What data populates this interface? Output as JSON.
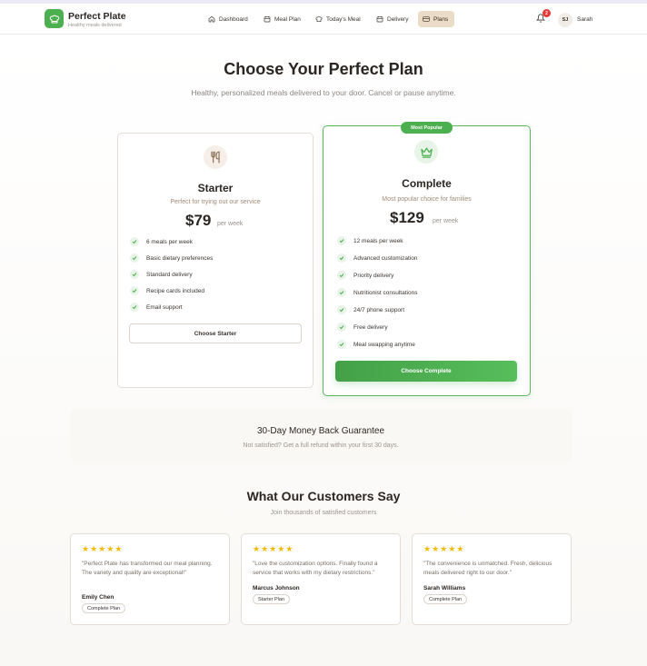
{
  "brand": {
    "name": "Perfect Plate",
    "tagline": "Healthy meals delivered"
  },
  "nav": {
    "items": [
      {
        "label": "Dashboard",
        "icon": "home-icon"
      },
      {
        "label": "Meal Plan",
        "icon": "calendar-icon"
      },
      {
        "label": "Today's Meal",
        "icon": "chef-hat-icon"
      },
      {
        "label": "Delivery",
        "icon": "calendar-icon"
      },
      {
        "label": "Plans",
        "icon": "credit-card-icon",
        "active": true
      }
    ],
    "notifications": "2",
    "user_initials": "SJ",
    "user_name": "Sarah"
  },
  "hero": {
    "title": "Choose Your Perfect Plan",
    "subtitle": "Healthy, personalized meals delivered to your door. Cancel or pause anytime."
  },
  "plans": [
    {
      "name": "Starter",
      "description": "Perfect for trying out our service",
      "price": "$79",
      "period": "per week",
      "features": [
        "6 meals per week",
        "Basic dietary preferences",
        "Standard delivery",
        "Recipe cards included",
        "Email support"
      ],
      "button": "Choose Starter"
    },
    {
      "name": "Complete",
      "badge": "Most Popular",
      "description": "Most popular choice for families",
      "price": "$129",
      "period": "per week",
      "features": [
        "12 meals per week",
        "Advanced customization",
        "Priority delivery",
        "Nutritionist consultations",
        "24/7 phone support",
        "Free delivery",
        "Meal swapping anytime"
      ],
      "button": "Choose Complete"
    }
  ],
  "guarantee": {
    "title": "30-Day Money Back Guarantee",
    "subtitle": "Not satisfied? Get a full refund within your first 30 days."
  },
  "testimonials": {
    "title": "What Our Customers Say",
    "subtitle": "Join thousands of satisfied customers",
    "items": [
      {
        "rating": 5,
        "quote": "\"Perfect Plate has transformed our meal planning. The variety and quality are exceptional!\"",
        "author": "Emily Chen",
        "plan": "Complete Plan"
      },
      {
        "rating": 5,
        "quote": "\"Love the customization options. Finally found a service that works with my dietary restrictions.\"",
        "author": "Marcus Johnson",
        "plan": "Starter Plan"
      },
      {
        "rating": 5,
        "quote": "\"The convenience is unmatched. Fresh, delicious meals delivered right to our door.\"",
        "author": "Sarah Williams",
        "plan": "Complete Plan"
      }
    ]
  },
  "colors": {
    "accent": "#4caf50",
    "active_nav": "#eadcc7",
    "star": "#f5b800",
    "badge": "#e53935"
  }
}
